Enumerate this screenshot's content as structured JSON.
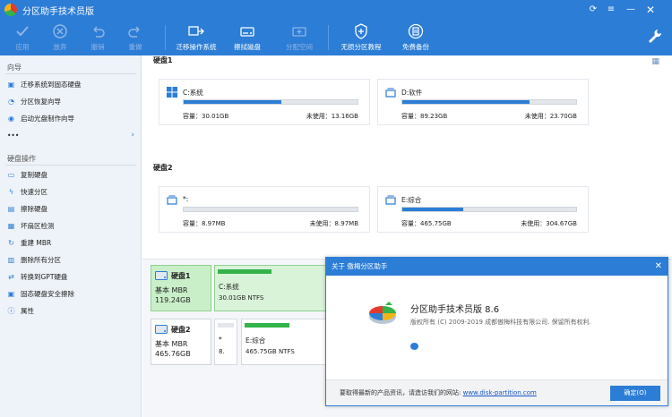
{
  "app": {
    "title": "分区助手技术员版"
  },
  "toolbar": {
    "apply": "应用",
    "discard": "放弃",
    "undo": "撤销",
    "redo": "重做",
    "migrate": "迁移操作系统",
    "wipe": "擦拭磁盘",
    "allocate": "分配空间",
    "lossless": "无损分区教程",
    "backup": "免费备份"
  },
  "sidebar": {
    "wizard_header": "向导",
    "wizard_items": [
      "迁移系统到固态硬盘",
      "分区恢复向导",
      "启动光盘制作向导"
    ],
    "more": "•••",
    "disk_header": "硬盘操作",
    "disk_items": [
      "复制硬盘",
      "快速分区",
      "擦除硬盘",
      "坏扇区检测",
      "重建 MBR",
      "删除所有分区",
      "转换到GPT硬盘",
      "固态硬盘安全擦除",
      "属性"
    ]
  },
  "main": {
    "disk1_label": "硬盘1",
    "disk2_label": "硬盘2",
    "cards": [
      {
        "name": "C:系统",
        "cap": "容量：30.01GB",
        "free": "未使用：13.16GB",
        "used_pct": 56
      },
      {
        "name": "D:软件",
        "cap": "容量：89.23GB",
        "free": "未使用：23.70GB",
        "used_pct": 73
      },
      {
        "name": "*:",
        "cap": "容量：8.97MB",
        "free": "未使用：8.97MB",
        "used_pct": 0
      },
      {
        "name": "E:综合",
        "cap": "容量：465.75GB",
        "free": "未使用：304.67GB",
        "used_pct": 35
      }
    ]
  },
  "lower": {
    "disk1": {
      "name": "硬盘1",
      "type": "基本 MBR",
      "size": "119.24GB"
    },
    "disk1_part": {
      "name": "C:系统",
      "info": "30.01GB NTFS"
    },
    "disk2": {
      "name": "硬盘2",
      "type": "基本 MBR",
      "size": "465.76GB"
    },
    "disk2_star": {
      "name": "*",
      "info": "8."
    },
    "disk2_part": {
      "name": "E:综合",
      "info": "465.75GB NTFS"
    }
  },
  "dialog": {
    "title": "关于 傲梅分区助手",
    "product": "分区助手技术员版 8.6",
    "copyright": "版权所有 (C) 2009-2019 成都傲梅科技有限公司. 保留所有权利.",
    "msg": "要取得最新的产品资讯，请造访我们的网站: ",
    "link": "www.disk-partition.com",
    "ok": "确定(O)"
  },
  "colors": {
    "accent": "#2c7dd6",
    "used": "#2c7dd6",
    "partition": "#33b34a"
  }
}
